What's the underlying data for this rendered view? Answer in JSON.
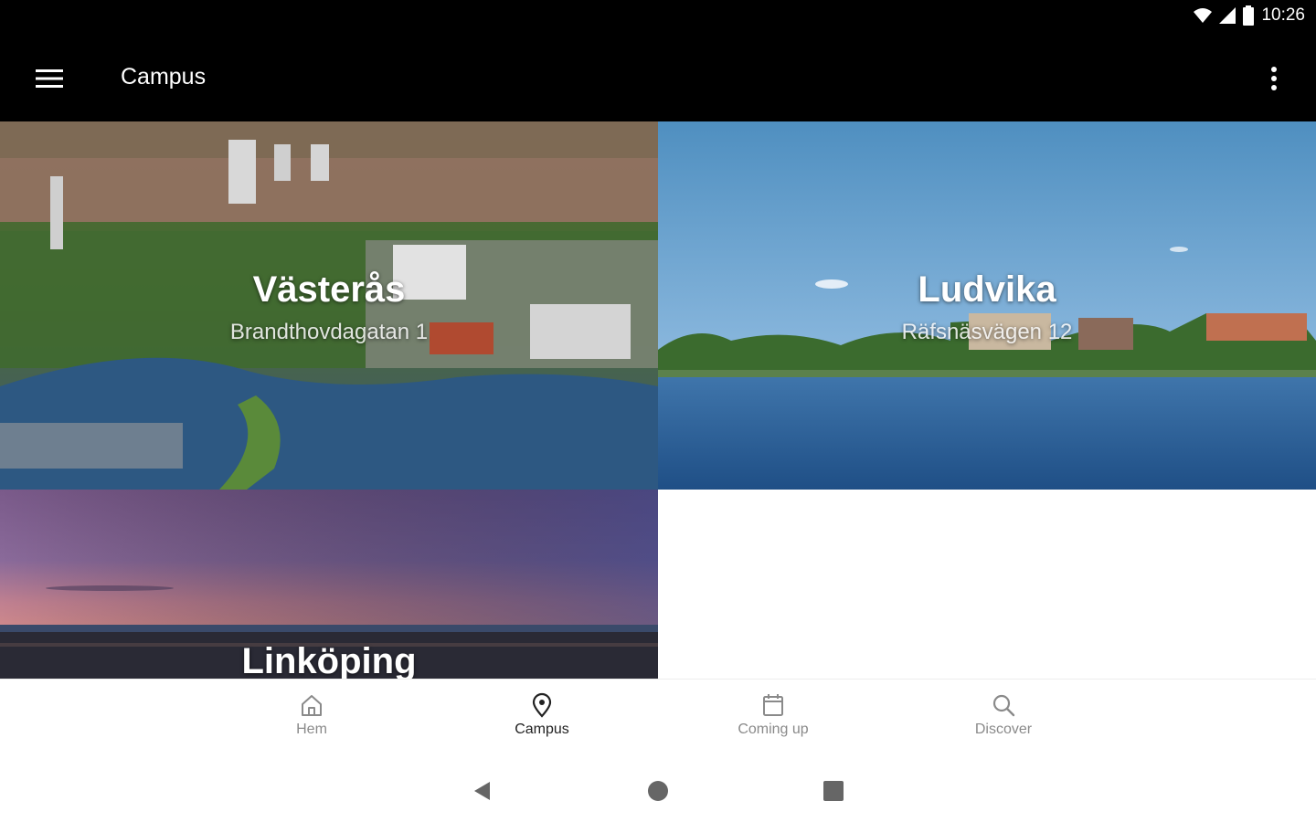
{
  "status": {
    "time": "10:26"
  },
  "appbar": {
    "title": "Campus"
  },
  "campuses": [
    {
      "name": "Västerås",
      "address": "Brandthovdagatan 1"
    },
    {
      "name": "Ludvika",
      "address": "Räfsnäsvägen 12"
    },
    {
      "name": "Linköping",
      "address": ""
    }
  ],
  "bottomnav": {
    "items": [
      {
        "label": "Hem",
        "icon": "home-icon"
      },
      {
        "label": "Campus",
        "icon": "location-pin-icon",
        "active": true
      },
      {
        "label": "Coming up",
        "icon": "calendar-icon"
      },
      {
        "label": "Discover",
        "icon": "search-icon"
      }
    ]
  },
  "colors": {
    "appbar": "#000000",
    "active": "#222222",
    "inactive": "#8a8a8a"
  }
}
